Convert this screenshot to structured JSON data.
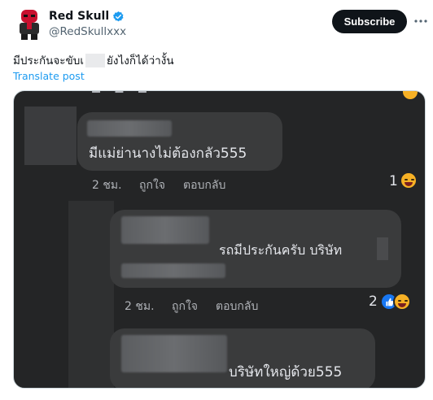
{
  "post": {
    "author_name": "Red Skull",
    "author_handle": "@RedSkullxxx",
    "subscribe_label": "Subscribe",
    "text_before": "มีประกันจะขับเ",
    "text_after": "ยังไงก็ได้ว่างั้น",
    "translate_label": "Translate post"
  },
  "media": {
    "comment1": {
      "text": "มีแม่ย่านางไม่ต้องกลัว555",
      "time": "2 ชม.",
      "like": "ถูกใจ",
      "reply": "ตอบกลับ",
      "reaction_count": "1"
    },
    "comment2": {
      "text": "รถมีประกันครับ  บริษัท",
      "time": "2 ชม.",
      "like": "ถูกใจ",
      "reply": "ตอบกลับ",
      "reaction_count": "2"
    },
    "comment3": {
      "text": "บริษัทใหญ่ด้วย555"
    }
  },
  "colors": {
    "subscribe_bg": "#0f1419",
    "link": "#1d9bf0",
    "verified": "#1d9bf0",
    "fb_bg": "#242526",
    "bubble": "#3a3b3c"
  },
  "icons": [
    "avatar-red-skull",
    "verified-badge-icon",
    "more-icon",
    "haha-emoji-icon",
    "like-reaction-icon"
  ]
}
